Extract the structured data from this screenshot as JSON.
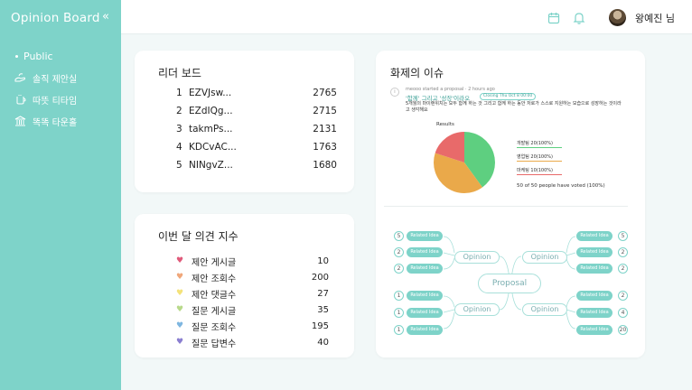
{
  "sidebar": {
    "brand": "Opinion Board",
    "collapse_icon": "double-chevron-left-icon",
    "items": [
      {
        "label": "Public",
        "icon": "dot-icon"
      },
      {
        "label": "솔직 제안실",
        "icon": "hands-icon"
      },
      {
        "label": "따뜻 티타임",
        "icon": "tea-cup-icon"
      },
      {
        "label": "똑똑 타운홀",
        "icon": "town-hall-icon"
      }
    ]
  },
  "header": {
    "user": "왕예진 님",
    "icons": [
      "calendar-icon",
      "bell-icon"
    ]
  },
  "leaderboard": {
    "title": "리더 보드",
    "rows": [
      {
        "rank": "1",
        "name": "EZVJsw...",
        "score": "2765"
      },
      {
        "rank": "2",
        "name": "EZdIQg...",
        "score": "2715"
      },
      {
        "rank": "3",
        "name": "takmPs...",
        "score": "2131"
      },
      {
        "rank": "4",
        "name": "KDCvAC...",
        "score": "1763"
      },
      {
        "rank": "5",
        "name": "NINgvZ...",
        "score": "1680"
      }
    ]
  },
  "opinion_index": {
    "title": "이번 달 의견 지수",
    "rows": [
      {
        "label": "제안 게시글",
        "value": "10",
        "color": "#e05a7a"
      },
      {
        "label": "제안 조회수",
        "value": "200",
        "color": "#f0a77a"
      },
      {
        "label": "제안 댓글수",
        "value": "27",
        "color": "#f4e27a"
      },
      {
        "label": "질문 게시글",
        "value": "35",
        "color": "#b8d98a"
      },
      {
        "label": "질문 조회수",
        "value": "195",
        "color": "#7eb6e0"
      },
      {
        "label": "질문 답변수",
        "value": "40",
        "color": "#8a7ed0"
      }
    ]
  },
  "hot_issue": {
    "title": "화제의 이슈",
    "author_line": "meooo started a proposal · 2 hours ago",
    "proposal_title": "'함께' 그리고 '성장'이라오",
    "tag": "Closing Thu Oct 8 00:00",
    "body": "5개월의 마이랜위치는 모두 함께 하는 것 그리고 함께 하는 동안 저로가 스스로 지원하는 모습으로 성장하는 것이라고 생각해요",
    "results_label": "Results",
    "options": [
      {
        "label": "개발팀 20(100%)",
        "color": "#5ecf80",
        "pct": 40
      },
      {
        "label": "영업팀 20(100%)",
        "color": "#eaa94a",
        "pct": 40
      },
      {
        "label": "마케팅 10(100%)",
        "color": "#e86a6a",
        "pct": 20
      }
    ],
    "vote_summary": "50 of 50 people have voted (100%)"
  },
  "mindmap": {
    "proposal_label": "Proposal",
    "opinion_label": "Opinion",
    "related_label": "Related Idea",
    "left_counts": [
      "5",
      "2",
      "2",
      "1",
      "1",
      "1"
    ],
    "right_counts": [
      "5",
      "2",
      "2",
      "2",
      "4",
      "20"
    ]
  },
  "colors": {
    "accent": "#7ed3c9"
  }
}
